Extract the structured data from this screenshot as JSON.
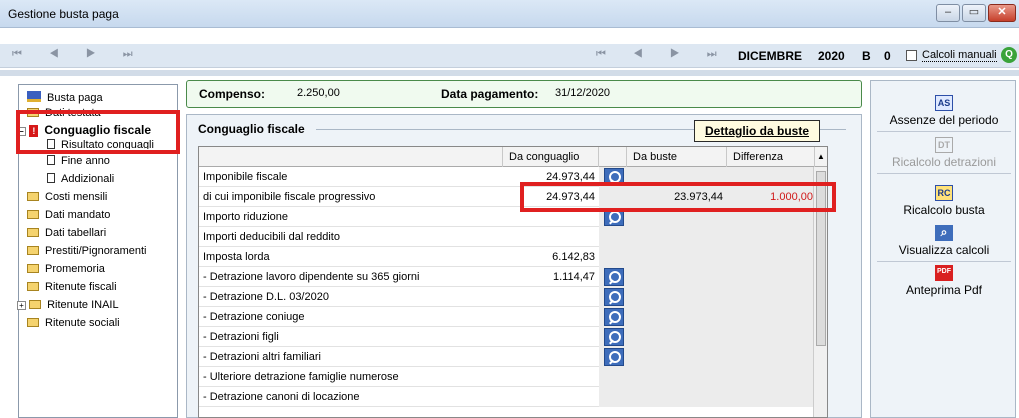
{
  "window": {
    "title": "Gestione busta paga",
    "buttons": {
      "minimize": "–",
      "maximize": "▭",
      "close": "✕"
    }
  },
  "navbar": {
    "left_arrows": "⏮ ◀ ▶ ⏭",
    "right_arrows": "⏮ ◀ ▶ ⏭",
    "month": "DICEMBRE",
    "year": "2020",
    "code_b": "B",
    "code_zero": "0",
    "calcoli_manuali": "Calcoli manuali"
  },
  "tree": {
    "items": [
      {
        "label": "Busta paga"
      },
      {
        "label": "Dati testata"
      },
      {
        "label": "Conguaglio fiscale"
      },
      {
        "label": "Risultato conguagli"
      },
      {
        "label": "Fine anno"
      },
      {
        "label": "Addizionali"
      },
      {
        "label": "Costi mensili"
      },
      {
        "label": "Dati mandato"
      },
      {
        "label": "Dati tabellari"
      },
      {
        "label": "Prestiti/Pignoramenti"
      },
      {
        "label": "Promemoria"
      },
      {
        "label": "Ritenute fiscali"
      },
      {
        "label": "Ritenute INAIL"
      },
      {
        "label": "Ritenute sociali"
      }
    ]
  },
  "header": {
    "compenso_label": "Compenso:",
    "compenso_value": "2.250,00",
    "data_label": "Data pagamento:",
    "data_value": "31/12/2020"
  },
  "section": {
    "title": "Conguaglio fiscale",
    "detail_button": "Dettaglio da buste"
  },
  "grid": {
    "columns": [
      "Da conguaglio",
      "Da buste",
      "Differenza"
    ],
    "rows": [
      {
        "label": "Imponibile fiscale",
        "da_conguaglio": "24.973,44",
        "da_buste": "",
        "differenza": ""
      },
      {
        "label": "di cui imponibile fiscale progressivo",
        "da_conguaglio": "24.973,44",
        "da_buste": "23.973,44",
        "differenza": "1.000,00"
      },
      {
        "label": "Importo riduzione",
        "da_conguaglio": "",
        "da_buste": "",
        "differenza": ""
      },
      {
        "label": "Importi deducibili dal reddito",
        "da_conguaglio": "",
        "da_buste": "",
        "differenza": ""
      },
      {
        "label": "Imposta lorda",
        "da_conguaglio": "6.142,83",
        "da_buste": "",
        "differenza": ""
      },
      {
        "label": "- Detrazione lavoro dipendente su 365 giorni",
        "da_conguaglio": "1.114,47",
        "da_buste": "",
        "differenza": ""
      },
      {
        "label": "- Detrazione D.L. 03/2020",
        "da_conguaglio": "",
        "da_buste": "",
        "differenza": ""
      },
      {
        "label": "- Detrazione coniuge",
        "da_conguaglio": "",
        "da_buste": "",
        "differenza": ""
      },
      {
        "label": "- Detrazioni figli",
        "da_conguaglio": "",
        "da_buste": "",
        "differenza": ""
      },
      {
        "label": "- Detrazioni altri familiari",
        "da_conguaglio": "",
        "da_buste": "",
        "differenza": ""
      },
      {
        "label": "- Ulteriore detrazione famiglie numerose",
        "da_conguaglio": "",
        "da_buste": "",
        "differenza": ""
      },
      {
        "label": "- Detrazione canoni di locazione",
        "da_conguaglio": "",
        "da_buste": "",
        "differenza": ""
      }
    ]
  },
  "actions": {
    "assenze": {
      "icon": "AS",
      "label": "Assenze del periodo"
    },
    "ricalcolo_detrazioni": {
      "icon": "DT",
      "label": "Ricalcolo detrazioni"
    },
    "ricalcolo_busta": {
      "icon": "RC",
      "label": "Ricalcolo busta"
    },
    "visualizza": {
      "icon": "⌕",
      "label": "Visualizza calcoli"
    },
    "anteprima": {
      "icon": "PDF",
      "label": "Anteprima Pdf"
    }
  },
  "colors": {
    "highlight": "#e02020",
    "diff_text": "#d01818",
    "search_bg": "#3e6dbb"
  }
}
